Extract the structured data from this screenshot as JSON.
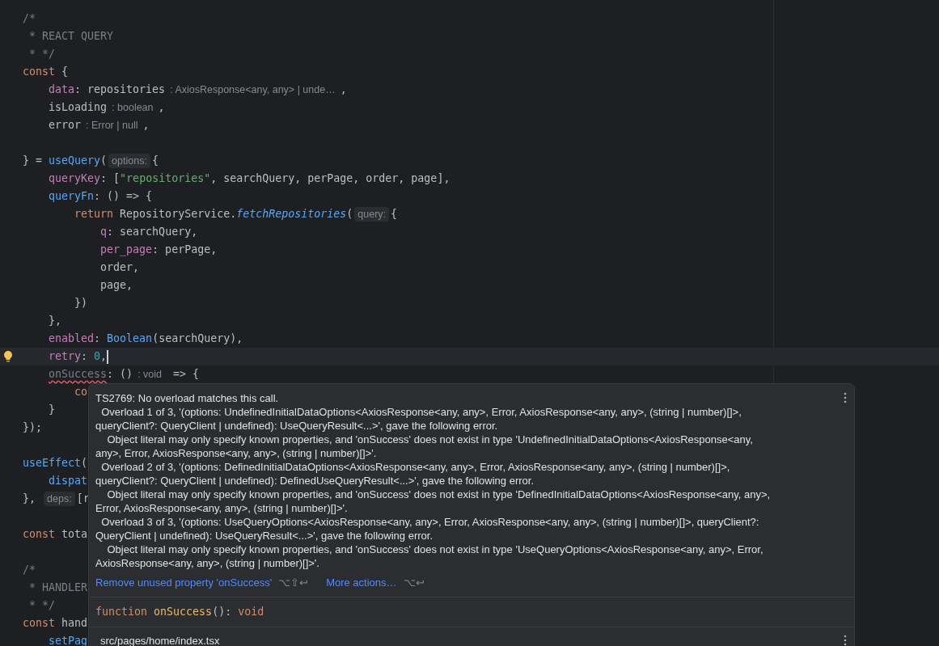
{
  "editor": {
    "lines": [
      {
        "tokens": [
          {
            "t": "/*",
            "kind": "comment"
          }
        ]
      },
      {
        "tokens": [
          {
            "t": " * REACT QUERY",
            "kind": "comment"
          }
        ]
      },
      {
        "tokens": [
          {
            "t": " * */",
            "kind": "comment"
          }
        ]
      },
      {
        "tokens": [
          {
            "t": "const",
            "kind": "kw"
          },
          {
            "t": " {",
            "kind": "plain"
          }
        ]
      },
      {
        "tokens": [
          {
            "t": "    data",
            "kind": "prop"
          },
          {
            "t": ": repositories",
            "kind": "plain"
          },
          {
            "t": ": AxiosResponse<any, any> | unde…",
            "kind": "type_hint"
          },
          {
            "t": ",",
            "kind": "plain"
          }
        ]
      },
      {
        "tokens": [
          {
            "t": "    isLoading",
            "kind": "plain"
          },
          {
            "t": ": boolean",
            "kind": "type_hint"
          },
          {
            "t": ",",
            "kind": "plain"
          }
        ]
      },
      {
        "blank_after": true,
        "tokens": [
          {
            "t": "    error",
            "kind": "plain"
          },
          {
            "t": ": Error | null",
            "kind": "type_hint"
          },
          {
            "t": ",",
            "kind": "plain"
          }
        ]
      },
      {
        "tokens": [
          {
            "t": "} = ",
            "kind": "plain"
          },
          {
            "t": "useQuery",
            "kind": "fn"
          },
          {
            "t": "(",
            "kind": "plain"
          },
          {
            "t": "options:",
            "kind": "param_hint"
          },
          {
            "t": "{",
            "kind": "plain"
          }
        ]
      },
      {
        "tokens": [
          {
            "t": "    queryKey",
            "kind": "prop"
          },
          {
            "t": ": [",
            "kind": "plain"
          },
          {
            "t": "\"repositories\"",
            "kind": "str"
          },
          {
            "t": ", searchQuery, perPage, order, page],",
            "kind": "plain"
          }
        ]
      },
      {
        "tokens": [
          {
            "t": "    queryFn",
            "kind": "fn"
          },
          {
            "t": ": () => {",
            "kind": "plain"
          }
        ]
      },
      {
        "tokens": [
          {
            "t": "        return",
            "kind": "kw"
          },
          {
            "t": " RepositoryService.",
            "kind": "plain"
          },
          {
            "t": "fetchRepositories",
            "kind": "fn_italic"
          },
          {
            "t": "(",
            "kind": "plain"
          },
          {
            "t": "query:",
            "kind": "param_hint"
          },
          {
            "t": "{",
            "kind": "plain"
          }
        ]
      },
      {
        "tokens": [
          {
            "t": "            q",
            "kind": "prop"
          },
          {
            "t": ": searchQuery,",
            "kind": "plain"
          }
        ]
      },
      {
        "tokens": [
          {
            "t": "            per_page",
            "kind": "prop"
          },
          {
            "t": ": perPage,",
            "kind": "plain"
          }
        ]
      },
      {
        "tokens": [
          {
            "t": "            order,",
            "kind": "plain"
          }
        ]
      },
      {
        "tokens": [
          {
            "t": "            page,",
            "kind": "plain"
          }
        ]
      },
      {
        "tokens": [
          {
            "t": "        })",
            "kind": "plain"
          }
        ]
      },
      {
        "tokens": [
          {
            "t": "    },",
            "kind": "plain"
          }
        ]
      },
      {
        "tokens": [
          {
            "t": "    enabled",
            "kind": "prop"
          },
          {
            "t": ": ",
            "kind": "plain"
          },
          {
            "t": "Boolean",
            "kind": "fn"
          },
          {
            "t": "(searchQuery),",
            "kind": "plain"
          }
        ]
      },
      {
        "current": true,
        "tokens": [
          {
            "t": "    retry",
            "kind": "prop"
          },
          {
            "t": ": ",
            "kind": "plain"
          },
          {
            "t": "0",
            "kind": "num"
          },
          {
            "t": ",",
            "kind": "plain"
          }
        ]
      },
      {
        "tokens": [
          {
            "t": "    onSuccess",
            "kind": "unused"
          },
          {
            "t": ": ()",
            "kind": "plain"
          },
          {
            "t": ": void",
            "kind": "type_hint"
          },
          {
            "t": " => {",
            "kind": "plain"
          }
        ]
      },
      {
        "tokens": [
          {
            "t": "        co",
            "kind": "kw"
          }
        ]
      },
      {
        "tokens": [
          {
            "t": "    }",
            "kind": "plain"
          }
        ]
      },
      {
        "blank_after": true,
        "tokens": [
          {
            "t": "});",
            "kind": "plain"
          }
        ]
      },
      {
        "tokens": [
          {
            "t": "useEffect",
            "kind": "fn"
          },
          {
            "t": "(",
            "kind": "plain"
          }
        ]
      },
      {
        "tokens": [
          {
            "t": "    dispat",
            "kind": "fn"
          }
        ]
      },
      {
        "blank_after": true,
        "tokens": [
          {
            "t": "}, ",
            "kind": "plain"
          },
          {
            "t": "deps:",
            "kind": "param_hint"
          },
          {
            "t": "[r",
            "kind": "plain"
          }
        ]
      },
      {
        "blank_after": true,
        "tokens": [
          {
            "t": "const",
            "kind": "kw"
          },
          {
            "t": " tota",
            "kind": "plain"
          }
        ]
      },
      {
        "tokens": [
          {
            "t": "/*",
            "kind": "comment"
          }
        ]
      },
      {
        "tokens": [
          {
            "t": " * HANDLER",
            "kind": "comment"
          }
        ]
      },
      {
        "tokens": [
          {
            "t": " * */",
            "kind": "comment"
          }
        ]
      },
      {
        "tokens": [
          {
            "t": "const",
            "kind": "kw"
          },
          {
            "t": " hand",
            "kind": "plain"
          }
        ]
      },
      {
        "tokens": [
          {
            "t": "    setPag",
            "kind": "fn"
          }
        ]
      }
    ]
  },
  "popup": {
    "message": [
      "TS2769: No overload matches this call.",
      "  Overload 1 of 3, '(options: UndefinedInitialDataOptions<AxiosResponse<any, any>, Error, AxiosResponse<any, any>, (string | number)[]>,",
      "queryClient?: QueryClient | undefined): UseQueryResult<...>', gave the following error.",
      "    Object literal may only specify known properties, and 'onSuccess' does not exist in type 'UndefinedInitialDataOptions<AxiosResponse<any,",
      "any>, Error, AxiosResponse<any, any>, (string | number)[]>'.",
      "  Overload 2 of 3, '(options: DefinedInitialDataOptions<AxiosResponse<any, any>, Error, AxiosResponse<any, any>, (string | number)[]>,",
      "queryClient?: QueryClient | undefined): DefinedUseQueryResult<...>', gave the following error.",
      "    Object literal may only specify known properties, and 'onSuccess' does not exist in type 'DefinedInitialDataOptions<AxiosResponse<any, any>,",
      "Error, AxiosResponse<any, any>, (string | number)[]>'.",
      "  Overload 3 of 3, '(options: UseQueryOptions<AxiosResponse<any, any>, Error, AxiosResponse<any, any>, (string | number)[]>, queryClient?:",
      "QueryClient | undefined): UseQueryResult<...>', gave the following error.",
      "    Object literal may only specify known properties, and 'onSuccess' does not exist in type 'UseQueryOptions<AxiosResponse<any, any>, Error,",
      "AxiosResponse<any, any>, (string | number)[]>'."
    ],
    "actions": [
      {
        "label": "Remove unused property 'onSuccess'",
        "shortcut": "⌥⇧↩"
      },
      {
        "label": "More actions…",
        "shortcut": "⌥↩"
      }
    ],
    "signature": [
      {
        "t": "function ",
        "kind": "kw"
      },
      {
        "t": "onSuccess",
        "kind": "decl"
      },
      {
        "t": "(): ",
        "kind": "plain"
      },
      {
        "t": "void",
        "kind": "kw"
      }
    ],
    "file": "src/pages/home/index.tsx"
  }
}
